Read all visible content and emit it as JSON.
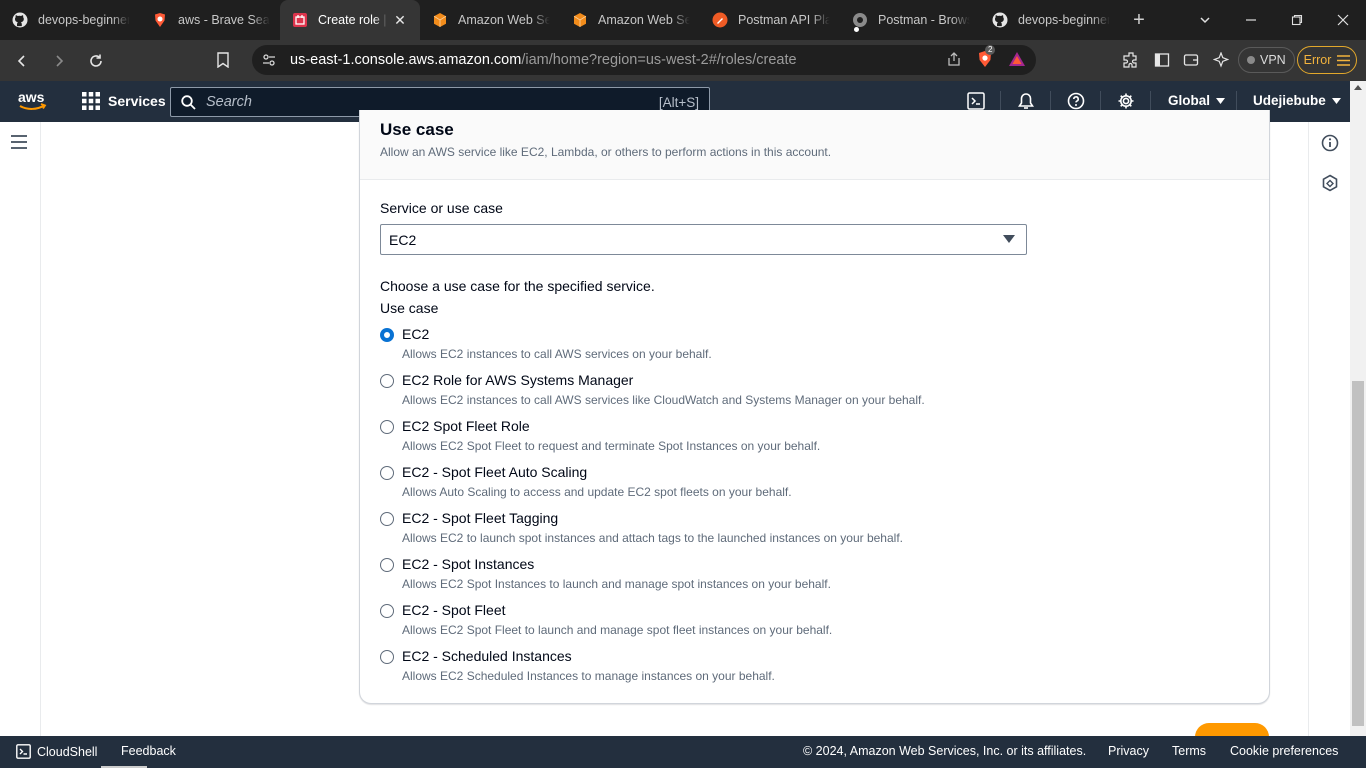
{
  "browser": {
    "tabs": [
      {
        "title": "devops-beginner",
        "favicon": "github-icon"
      },
      {
        "title": "aws - Brave Search",
        "favicon": "brave-search-icon"
      },
      {
        "title": "Create role | IAM",
        "favicon": "aws-iam-icon",
        "active": true,
        "close": "✕"
      },
      {
        "title": "Amazon Web Services",
        "favicon": "aws-cube-icon"
      },
      {
        "title": "Amazon Web Services",
        "favicon": "aws-cube-icon"
      },
      {
        "title": "Postman API Platform",
        "favicon": "postman-icon"
      },
      {
        "title": "Postman - Browser",
        "favicon": "postman-gray-icon"
      },
      {
        "title": "devops-beginner",
        "favicon": "github-icon"
      }
    ],
    "address": {
      "host": "us-east-1.console.aws.amazon.com",
      "path": "/iam/home?region=us-west-2#/roles/create"
    },
    "brave_badge": "2",
    "vpn_label": "VPN",
    "error_label": "Error"
  },
  "aws_nav": {
    "services_label": "Services",
    "search_placeholder": "Search",
    "search_shortcut": "[Alt+S]",
    "region_label": "Global",
    "account_label": "Udejiebube"
  },
  "use_case_panel": {
    "title": "Use case",
    "description": "Allow an AWS service like EC2, Lambda, or others to perform actions in this account.",
    "service_label": "Service or use case",
    "service_value": "EC2",
    "choose_text": "Choose a use case for the specified service.",
    "use_case_label": "Use case",
    "options": [
      {
        "label": "EC2",
        "desc": "Allows EC2 instances to call AWS services on your behalf.",
        "selected": true
      },
      {
        "label": "EC2 Role for AWS Systems Manager",
        "desc": "Allows EC2 instances to call AWS services like CloudWatch and Systems Manager on your behalf.",
        "selected": false
      },
      {
        "label": "EC2 Spot Fleet Role",
        "desc": "Allows EC2 Spot Fleet to request and terminate Spot Instances on your behalf.",
        "selected": false
      },
      {
        "label": "EC2 - Spot Fleet Auto Scaling",
        "desc": "Allows Auto Scaling to access and update EC2 spot fleets on your behalf.",
        "selected": false
      },
      {
        "label": "EC2 - Spot Fleet Tagging",
        "desc": "Allows EC2 to launch spot instances and attach tags to the launched instances on your behalf.",
        "selected": false
      },
      {
        "label": "EC2 - Spot Instances",
        "desc": "Allows EC2 Spot Instances to launch and manage spot instances on your behalf.",
        "selected": false
      },
      {
        "label": "EC2 - Spot Fleet",
        "desc": "Allows EC2 Spot Fleet to launch and manage spot fleet instances on your behalf.",
        "selected": false
      },
      {
        "label": "EC2 - Scheduled Instances",
        "desc": "Allows EC2 Scheduled Instances to manage instances on your behalf.",
        "selected": false
      }
    ]
  },
  "footer": {
    "cloudshell": "CloudShell",
    "feedback": "Feedback",
    "copyright": "© 2024, Amazon Web Services, Inc. or its affiliates.",
    "privacy": "Privacy",
    "terms": "Terms",
    "cookie": "Cookie preferences"
  },
  "colors": {
    "aws_nav_bg": "#232f3e",
    "primary_orange": "#ff9900",
    "link_blue": "#0972d3",
    "error_outline": "#e3a82b"
  }
}
